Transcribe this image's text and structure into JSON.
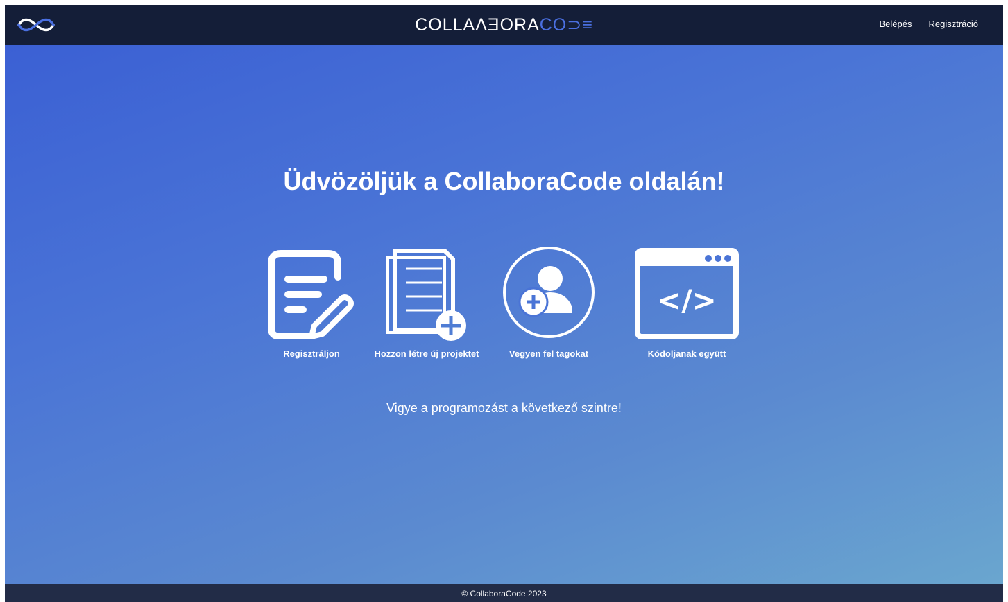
{
  "header": {
    "brand_main": "COLLAΛƎORA",
    "brand_accent": "CO⊃≡",
    "nav": {
      "login": "Belépés",
      "register": "Regisztráció"
    }
  },
  "hero": {
    "title": "Üdvözöljük a CollaboraCode oldalán!",
    "steps": [
      {
        "label": "Regisztráljon",
        "icon": "edit-form-icon"
      },
      {
        "label": "Hozzon létre új projektet",
        "icon": "new-document-icon"
      },
      {
        "label": "Vegyen fel tagokat",
        "icon": "add-user-icon"
      },
      {
        "label": "Kódoljanak együtt",
        "icon": "code-window-icon"
      }
    ],
    "tagline": "Vigye a programozást a következő szintre!"
  },
  "footer": {
    "text": "© CollaboraCode 2023"
  },
  "colors": {
    "navbar": "#141e38",
    "footer": "#222c47",
    "accent": "#4a6fe0",
    "gradient_start": "#3b60d4",
    "gradient_end": "#6aa6cf"
  }
}
